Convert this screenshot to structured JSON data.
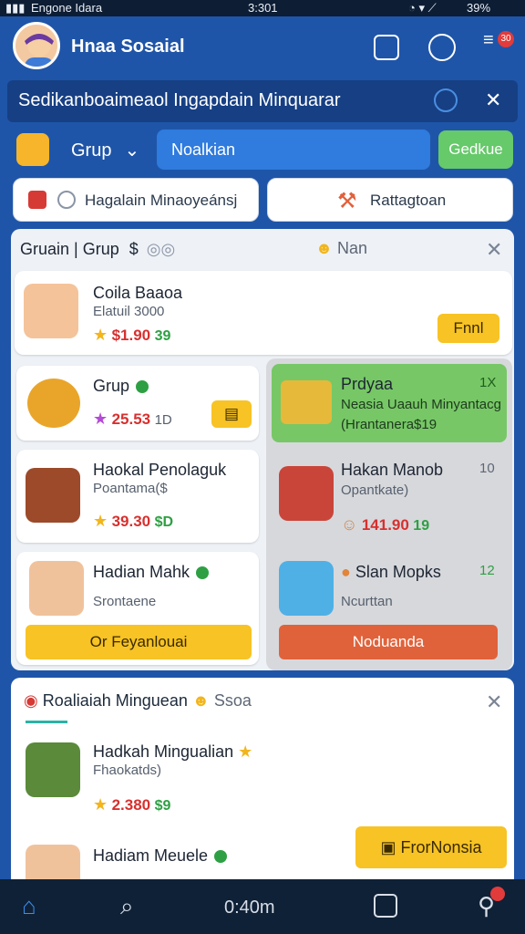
{
  "status_bar": {
    "carrier": "Engone Idara",
    "time": "3:301",
    "battery": "39%"
  },
  "header": {
    "title": "Hnaa Sosaial",
    "notification_count": "30"
  },
  "banner": {
    "text": "Sedikanboaimeaol Ingapdain Minquarar"
  },
  "filter": {
    "group_label": "Grup",
    "search_value": "Noalkian",
    "go_label": "Gedkue"
  },
  "pills": {
    "left_label": "Hagalain Minaoyeánsj",
    "right_label": "Rattagtoan"
  },
  "panel": {
    "title": "Gruain | Grup",
    "title_suffix": "$",
    "title_right": "Nan",
    "featured": {
      "name": "Coila Baaoa",
      "sub": "Elatuil 3000",
      "price": "$1.90",
      "count": "39",
      "button": "Fnnl"
    },
    "items_left": [
      {
        "name": "Grup",
        "price": "25.53",
        "count": "1D"
      },
      {
        "name": "Haokal Penolaguk",
        "sub": "Poantama($",
        "price": "39.30",
        "count": "$D"
      },
      {
        "name": "Hadian Mahk",
        "sub": "Srontaene"
      }
    ],
    "items_right": [
      {
        "name": "Prdyaa",
        "count": "1X",
        "sub": "Neasia Uaauh Minyantacg",
        "sub2": "(Hrantanera$19"
      },
      {
        "name": "Hakan Manob",
        "count": "10",
        "sub": "Opantkate)",
        "price": "141.90",
        "count2": "19"
      },
      {
        "name": "Slan Mopks",
        "count": "12",
        "sub": "Ncurttan"
      }
    ],
    "left_button": "Or Feyanlouai",
    "right_button": "Noduanda"
  },
  "section2": {
    "title": "Roaliaiah Minguean",
    "suffix": "Ssoa",
    "items": [
      {
        "name": "Hadkah Mingualian",
        "sub": "Fhaokatds)",
        "price": "2.380",
        "count": "$9"
      },
      {
        "name": "Hadiam Meuele"
      }
    ],
    "float_button": "FrorNonsia"
  },
  "bottom_nav": {
    "center": "0:40m"
  }
}
